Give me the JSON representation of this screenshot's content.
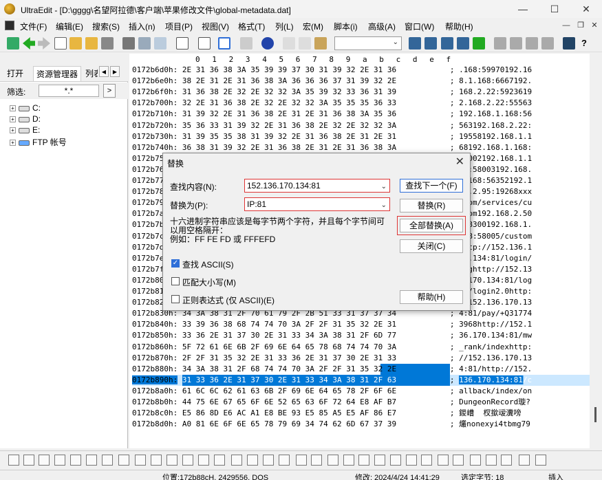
{
  "window": {
    "title": "UltraEdit - [D:\\gggg\\名望阿拉德\\客户端\\苹果修改文件\\global-metadata.dat]",
    "minimize": "—",
    "maximize": "☐",
    "close": "✕"
  },
  "menu": [
    "文件(F)",
    "编辑(E)",
    "搜索(S)",
    "插入(n)",
    "项目(P)",
    "视图(V)",
    "格式(T)",
    "列(L)",
    "宏(M)",
    "脚本(i)",
    "高级(A)",
    "窗口(W)",
    "帮助(H)"
  ],
  "mdi": {
    "minimize": "—",
    "restore": "❐",
    "close": "✕"
  },
  "toolbar_combo": "",
  "left_panel": {
    "tabs": [
      "打开",
      "资源管理器",
      "列表"
    ],
    "filter_label": "筛选:",
    "filter_value": "*.*",
    "filter_button": ">",
    "tree": [
      "C:",
      "D:",
      "E:",
      "FTP 帐号"
    ]
  },
  "ruler": [
    "0",
    "1",
    "2",
    "3",
    "4",
    "5",
    "6",
    "7",
    "8",
    "9",
    "a",
    "b",
    "c",
    "d",
    "e",
    "f"
  ],
  "hex_lines": [
    {
      "addr": "0172b6d0h:",
      "hex": "2E 31 36 38 3A 35 39 39 37 30 31 39 32 2E 31 36",
      "ascii": ".168:59970192.16"
    },
    {
      "addr": "0172b6e0h:",
      "hex": "38 2E 31 2E 31 36 38 3A 36 36 36 37 31 39 32 2E",
      "ascii": "8.1.168:6667192."
    },
    {
      "addr": "0172b6f0h:",
      "hex": "31 36 38 2E 32 2E 32 32 3A 35 39 32 33 36 31 39",
      "ascii": "168.2.22:5923619"
    },
    {
      "addr": "0172b700h:",
      "hex": "32 2E 31 36 38 2E 32 2E 32 32 3A 35 35 35 36 33",
      "ascii": "2.168.2.22:55563"
    },
    {
      "addr": "0172b710h:",
      "hex": "31 39 32 2E 31 36 38 2E 31 2E 31 36 38 3A 35 36",
      "ascii": "192.168.1.168:56"
    },
    {
      "addr": "0172b720h:",
      "hex": "35 36 33 31 39 32 2E 31 36 38 2E 32 2E 32 32 3A",
      "ascii": "563192.168.2.22:"
    },
    {
      "addr": "0172b730h:",
      "hex": "31 39 35 35 38 31 39 32 2E 31 36 38 2E 31 2E 31",
      "ascii": "19558192.168.1.1"
    },
    {
      "addr": "0172b740h:",
      "hex": "36 38 31 39 32 2E 31 36 38 2E 31 2E 31 36 38 3A",
      "ascii": "68192.168.1.168:"
    },
    {
      "addr": "0172b750h:",
      "hex": "",
      "ascii": "58002192.168.1.1"
    },
    {
      "addr": "0172b760h:",
      "hex": "",
      "ascii": "58:58003192.168."
    },
    {
      "addr": "0172b770h:",
      "hex": "",
      "ascii": "1.168:56352192.1"
    },
    {
      "addr": "0172b780h:",
      "hex": "",
      "ascii": "68.2.95:19268xxx"
    },
    {
      "addr": "0172b790h:",
      "hex": "",
      "ascii": ".com/services/cu"
    },
    {
      "addr": "0172b7a0h:",
      "hex": "",
      "ascii": "stom192.168.2.50"
    },
    {
      "addr": "0172b7b0h:",
      "hex": "",
      "ascii": ":58300192.168.1."
    },
    {
      "addr": "0172b7c0h:",
      "hex": "",
      "ascii": "168:58005/custom"
    },
    {
      "addr": "0172b7d0h:",
      "hex": "",
      "ascii": "http://152.136.1"
    },
    {
      "addr": "0172b7e0h:",
      "hex": "",
      "ascii": "70.134:81/login/"
    },
    {
      "addr": "0172b7f0h:",
      "hex": "",
      "ascii": "reghttp://152.13"
    },
    {
      "addr": "0172b800h:",
      "hex": "",
      "ascii": "6.170.134:81/log"
    },
    {
      "addr": "0172b810h:",
      "hex": "",
      "ascii": "in/login2.0http:"
    },
    {
      "addr": "0172b820h:",
      "hex": "",
      "ascii": "//152.136.170.13"
    },
    {
      "addr": "0172b830h:",
      "hex": "34 3A 38 31 2F 70 61 79 2F 2B 51 33 31 37 37 34",
      "ascii": "4:81/pay/+Q31774"
    },
    {
      "addr": "0172b840h:",
      "hex": "33 39 36 38 68 74 74 70 3A 2F 2F 31 35 32 2E 31",
      "ascii": "3968http://152.1"
    },
    {
      "addr": "0172b850h:",
      "hex": "33 36 2E 31 37 30 2E 31 33 34 3A 38 31 2F 6D 77",
      "ascii": "36.170.134:81/mw"
    },
    {
      "addr": "0172b860h:",
      "hex": "5F 72 61 6E 6B 2F 69 6E 64 65 78 68 74 74 70 3A",
      "ascii": "_rank/indexhttp:"
    },
    {
      "addr": "0172b870h:",
      "hex": "2F 2F 31 35 32 2E 31 33 36 2E 31 37 30 2E 31 33",
      "ascii": "//152.136.170.13"
    },
    {
      "addr": "0172b880h:",
      "hex": "34 3A 38 31 2F 68 74 74 70 3A 2F 2F 31 35 32 2E",
      "ascii": "4:81/http://152."
    },
    {
      "addr": "0172b890h:",
      "hex": "31 33 36 2E 31 37 30 2E 31 33 34 3A 38 31 2F 63",
      "ascii": "136.170.134:81/c"
    },
    {
      "addr": "0172b8a0h:",
      "hex": "61 6C 6C 62 61 63 6B 2F 69 6E 64 65 78 2F 6F 6E",
      "ascii": "allback/index/on"
    },
    {
      "addr": "0172b8b0h:",
      "hex": "44 75 6E 67 65 6F 6E 52 65 63 6F 72 64 E8 AF B7",
      "ascii": "DungeonRecord璇?"
    },
    {
      "addr": "0172b8c0h:",
      "hex": "E5 86 8D E6 AC A1 E8 BE 93 E5 85 A5 E5 AF 86 E7",
      "ascii": "鍐嶆  杈撳叆瀵嗙"
    },
    {
      "addr": "0172b8d0h:",
      "hex": "A0 81 6E 6F 6E 65 78 79 69 34 74 62 6D 67 37 39",
      "ascii": "爜nonexyi4tbmg79"
    }
  ],
  "dialog": {
    "title": "替换",
    "find_label": "查找内容(N):",
    "find_value": "152.136.170.134:81",
    "replace_label": "替换为(P):",
    "replace_value": "IP:81",
    "hint_line1": "十六进制字符串应该是每字节两个字符，并且每个字节间可",
    "hint_line2": "以用空格隔开：",
    "hint_line3": "例如：FF FE FD 或 FFFEFD",
    "opt_ascii": "查找 ASCII(S)",
    "opt_case": "匹配大小写(M)",
    "opt_regex": "正则表达式 (仅 ASCII)(E)",
    "btn_find_next": "查找下一个(F)",
    "btn_replace": "替换(R)",
    "btn_replace_all": "全部替换(A)",
    "btn_close": "关闭(C)",
    "btn_help": "帮助(H)",
    "close_icon": "✕"
  },
  "status": {
    "position": "位置:172b88cH, 2429556, DOS",
    "modified": "修改:  2024/4/24 14:41:29",
    "selected": "选定字节: 18",
    "mode": "插入"
  },
  "colors": {
    "selection": "#0078d7",
    "highlight_border": "#dd3333",
    "current_line": "#cce8ff"
  }
}
